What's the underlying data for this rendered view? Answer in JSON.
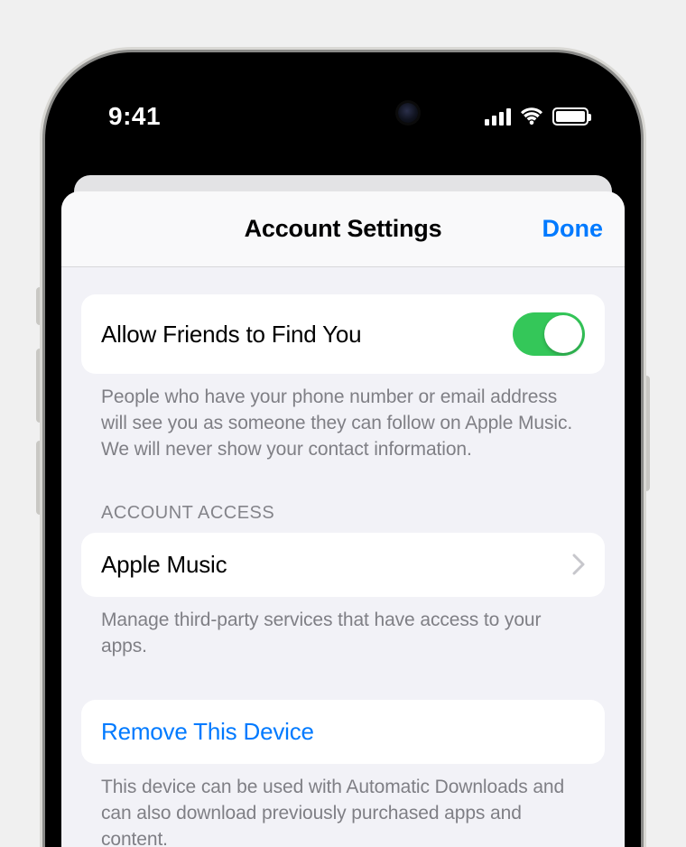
{
  "statusbar": {
    "time": "9:41"
  },
  "sheet": {
    "title": "Account Settings",
    "done": "Done"
  },
  "friends": {
    "label": "Allow Friends to Find You",
    "on": true,
    "footer": "People who have your phone number or email address will see you as someone they can follow on Apple Music. We will never show your contact information."
  },
  "access": {
    "header": "ACCOUNT ACCESS",
    "row_label": "Apple Music",
    "footer": "Manage third-party services that have access to your apps."
  },
  "remove": {
    "label": "Remove This Device",
    "footer": "This device can be used with Automatic Downloads and can also download previously purchased apps and content."
  }
}
